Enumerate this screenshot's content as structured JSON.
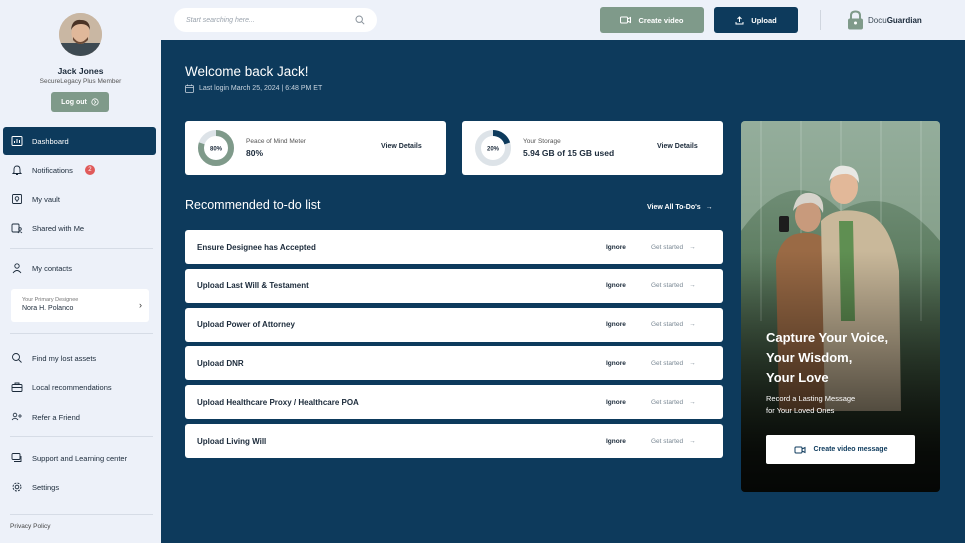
{
  "user": {
    "name": "Jack Jones",
    "tier": "SecureLegacy Plus Member",
    "logout_label": "Log out"
  },
  "nav": {
    "dashboard": "Dashboard",
    "notifications": "Notifications",
    "notifications_count": "2",
    "vault": "My vault",
    "shared": "Shared with Me",
    "contacts": "My contacts",
    "lost_assets": "Find my lost assets",
    "local": "Local recommendations",
    "refer": "Refer a Friend",
    "support": "Support and Learning center",
    "settings": "Settings"
  },
  "designee": {
    "label": "Your Primary Designee",
    "name": "Nora H. Polanco"
  },
  "footer": {
    "privacy": "Privacy Policy"
  },
  "search": {
    "placeholder": "Start searching here..."
  },
  "topbar": {
    "create_video": "Create video",
    "upload": "Upload",
    "brand_prefix": "Docu",
    "brand_suffix": "Guardian"
  },
  "welcome": {
    "title": "Welcome back Jack!",
    "last_login": "Last login March 25, 2024  |  6:48 PM ET"
  },
  "stats": [
    {
      "percent_label": "80%",
      "percent": 80,
      "label": "Peace of Mind Meter",
      "value": "80%",
      "link": "View Details",
      "color": "#7f9a8a"
    },
    {
      "percent_label": "20%",
      "percent": 20,
      "label": "Your Storage",
      "value": "5.94 GB of 15 GB used",
      "link": "View Details",
      "color": "#0d3a5c"
    }
  ],
  "todo": {
    "title": "Recommended to-do list",
    "view_all": "View All To-Do's",
    "ignore_label": "Ignore",
    "start_label": "Get started",
    "items": [
      "Ensure Designee has Accepted",
      "Upload Last Will & Testament",
      "Upload Power of Attorney",
      "Upload DNR",
      "Upload Healthcare Proxy / Healthcare POA",
      "Upload Living Will"
    ]
  },
  "promo": {
    "headline_1": "Capture Your Voice,",
    "headline_2": "Your Wisdom,",
    "headline_3": "Your Love",
    "sub_1": "Record a Lasting Message",
    "sub_2": "for Your Loved Ones",
    "button": "Create video message"
  }
}
